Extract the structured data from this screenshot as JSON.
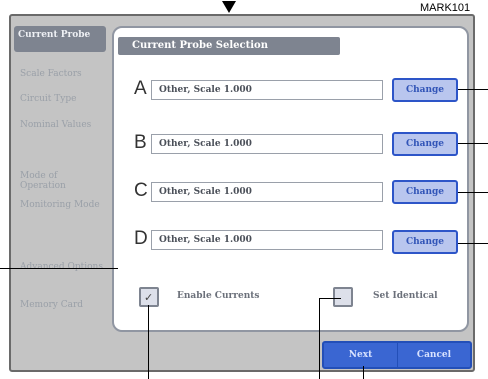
{
  "mark_label": "MARK101",
  "sidebar": {
    "items": [
      {
        "label": "Current Probe",
        "selected": true
      },
      {
        "label": "Scale Factors",
        "selected": false
      },
      {
        "label": "Circuit Type",
        "selected": false
      },
      {
        "label": "Nominal Values",
        "selected": false
      },
      {
        "label": "Mode of Operation",
        "selected": false
      },
      {
        "label": "Monitoring Mode",
        "selected": false
      },
      {
        "label": "Advanced Options",
        "selected": false
      },
      {
        "label": "Memory Card",
        "selected": false
      }
    ]
  },
  "panel": {
    "title": "Current Probe Selection",
    "phases": [
      {
        "letter": "A",
        "value": "Other, Scale 1.000",
        "button": "Change"
      },
      {
        "letter": "B",
        "value": "Other, Scale 1.000",
        "button": "Change"
      },
      {
        "letter": "C",
        "value": "Other, Scale 1.000",
        "button": "Change"
      },
      {
        "letter": "D",
        "value": "Other, Scale 1.000",
        "button": "Change"
      }
    ],
    "enable_currents": {
      "label": "Enable Currents",
      "checked": true
    },
    "set_identical": {
      "label": "Set Identical",
      "checked": false
    }
  },
  "footer": {
    "next_label": "Next",
    "cancel_label": "Cancel"
  },
  "colors": {
    "accent": "#3a66d2",
    "button_fill": "#b9c6ee",
    "sidebar_selected": "#7e8490"
  }
}
